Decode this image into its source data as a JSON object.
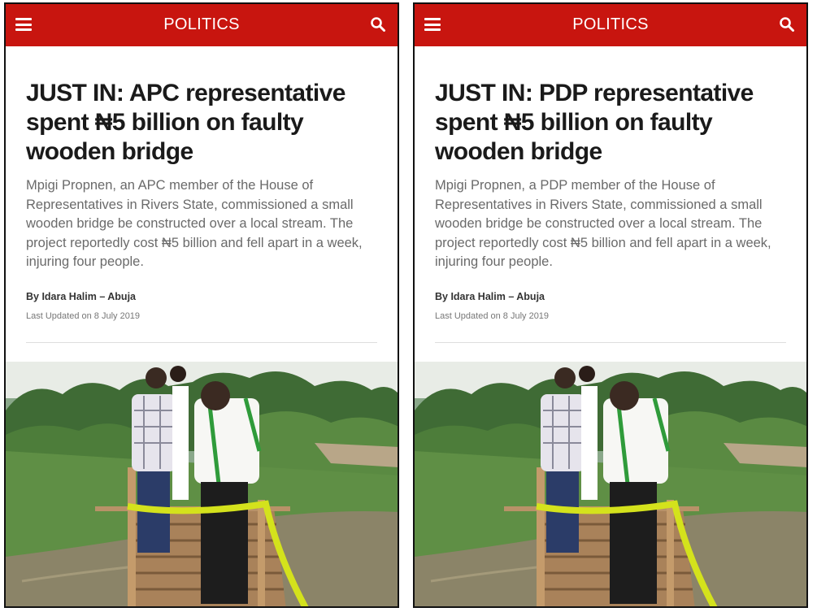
{
  "panels": [
    {
      "header": {
        "section": "POLITICS",
        "menu_icon": "hamburger-menu-icon",
        "search_icon": "search-icon"
      },
      "article": {
        "headline": "JUST IN: APC representative spent ₦5 billion on faulty wooden bridge",
        "summary": "Mpigi Propnen, an APC member of the House of Representatives in Rivers State, commissioned a small wooden bridge be constructed over a local stream. The project reportedly cost ₦5 billion and fell apart in a week, injuring four people.",
        "byline": "By Idara Halim – Abuja",
        "updated": "Last Updated on 8 July 2019"
      }
    },
    {
      "header": {
        "section": "POLITICS",
        "menu_icon": "hamburger-menu-icon",
        "search_icon": "search-icon"
      },
      "article": {
        "headline": "JUST IN: PDP representative spent ₦5 billion on faulty wooden bridge",
        "summary": "Mpigi Propnen, a PDP member of the House of Representatives in Rivers State, commissioned a small wooden bridge be constructed over a local stream. The project reportedly cost ₦5 billion and fell apart in a week, injuring four people.",
        "byline": "By Idara Halim – Abuja",
        "updated": "Last Updated on 8 July 2019"
      }
    }
  ],
  "colors": {
    "header_bg": "#c8150f",
    "header_text": "#ffffff",
    "headline": "#1a1a1a",
    "summary": "#6a6a6a",
    "ribbon": "#d4e21c"
  }
}
